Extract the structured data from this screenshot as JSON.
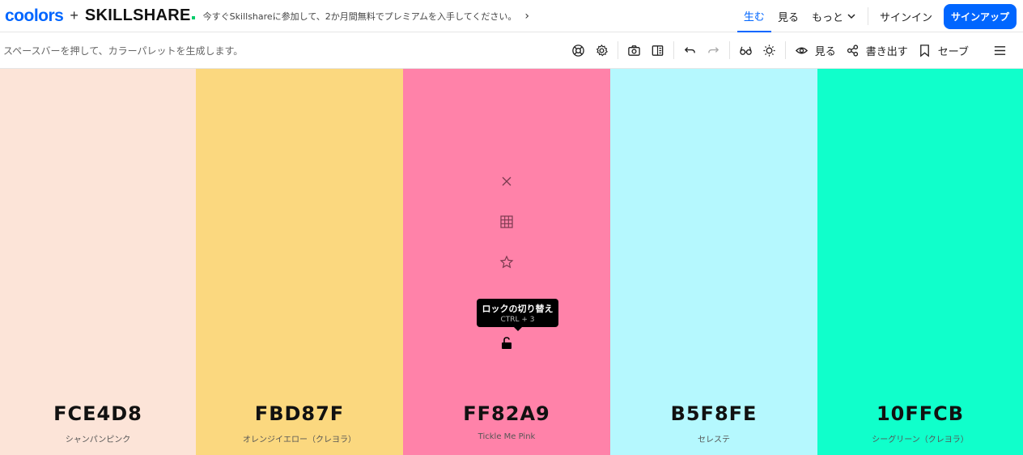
{
  "nav": {
    "logo_coolors": "coolors",
    "logo_plus": "+",
    "logo_skillshare": "SKILLSHARE",
    "promo": "今すぐSkillshareに参加して、2か月間無料でプレミアムを入手してください。",
    "promo_arrow": "›",
    "items": [
      "生む",
      "見る",
      "もっと"
    ],
    "signin": "サインイン",
    "signup": "サインアップ",
    "accent": "#0066ff"
  },
  "toolbar": {
    "hint": "スペースバーを押して、カラーパレットを生成します。",
    "view_label": "見る",
    "export_label": "書き出す",
    "save_label": "セーブ"
  },
  "palette": {
    "colors": [
      {
        "hex": "FCE4D8",
        "name": "シャンパンピンク",
        "color": "#FCE4D8"
      },
      {
        "hex": "FBD87F",
        "name": "オレンジイエロー（クレヨラ）",
        "color": "#FBD87F"
      },
      {
        "hex": "FF82A9",
        "name": "Tickle Me Pink",
        "color": "#FF82A9"
      },
      {
        "hex": "B5F8FE",
        "name": "セレステ",
        "color": "#B5F8FE"
      },
      {
        "hex": "10FFCB",
        "name": "シーグリーン（クレヨラ）",
        "color": "#10FFCB"
      }
    ],
    "tooltip": {
      "title": "ロックの切り替え",
      "shortcut": "CTRL + 3"
    }
  }
}
